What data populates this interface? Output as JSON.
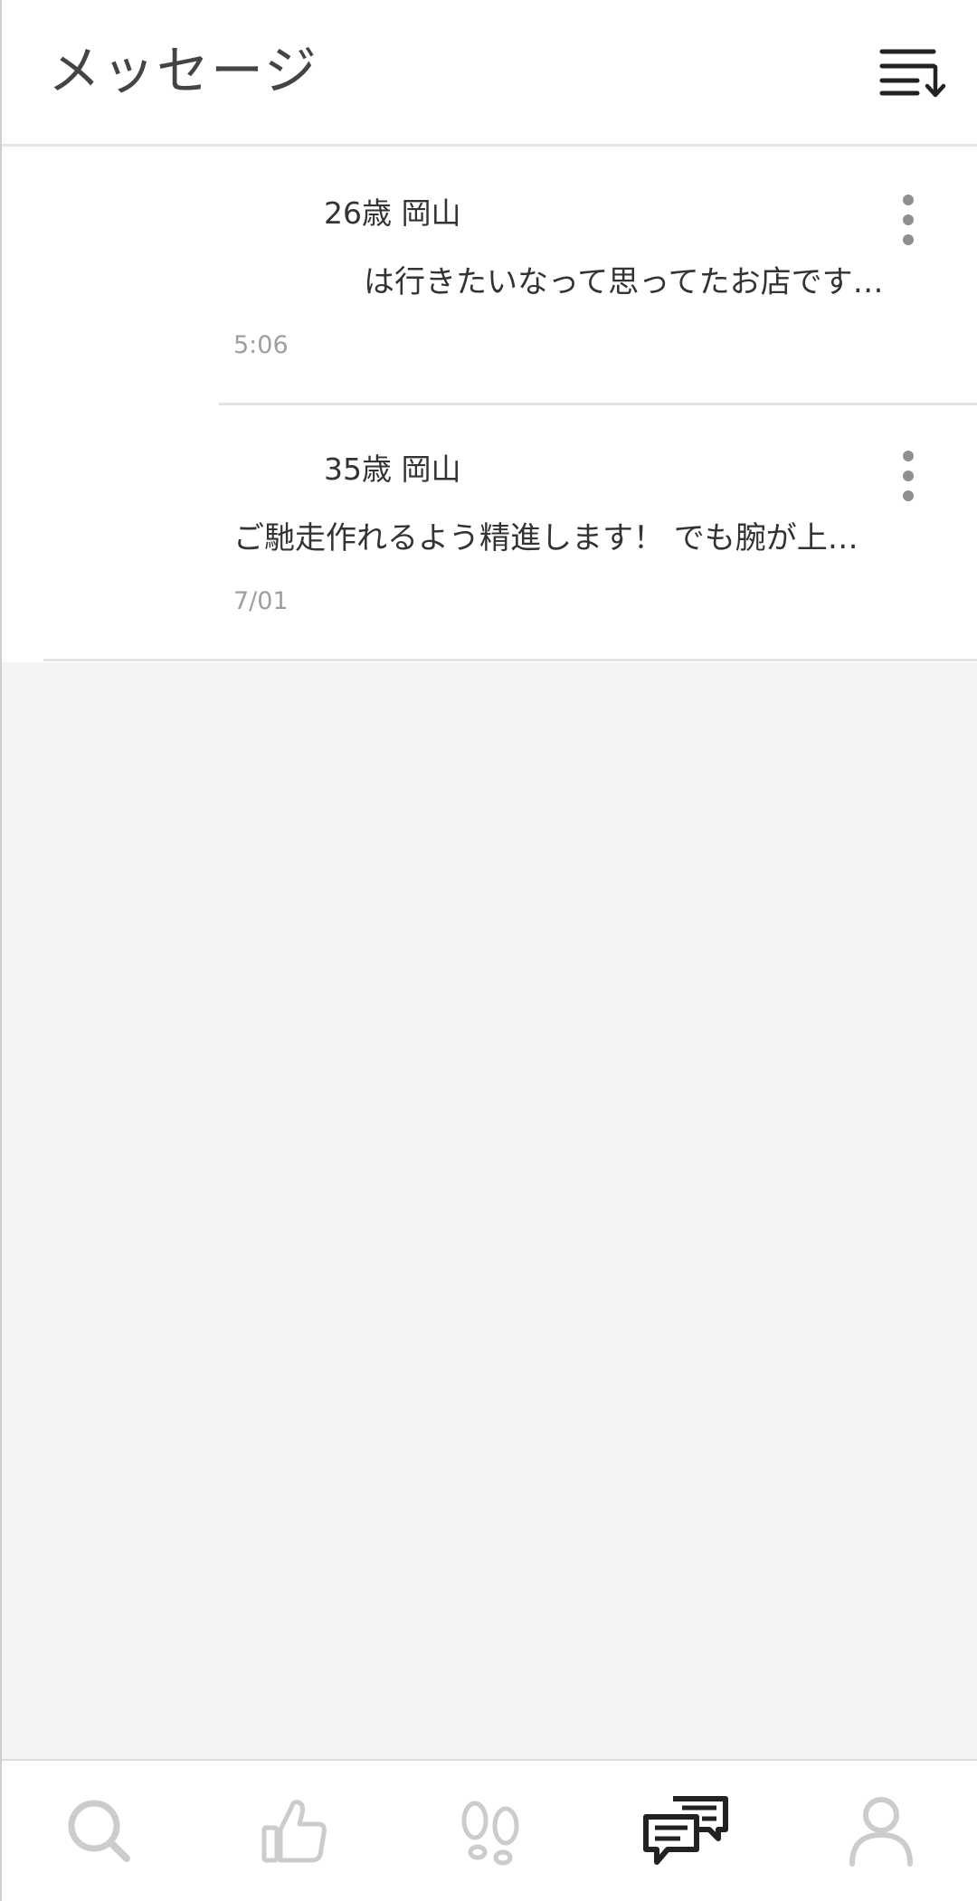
{
  "header": {
    "title": "メッセージ",
    "sort_icon": "sort-descending-icon"
  },
  "messages": [
    {
      "name": "26歳 岡山",
      "preview": "は行きたいなって思ってたお店です…",
      "time": "5:06"
    },
    {
      "name": "35歳 岡山",
      "preview": "ご馳走作れるよう精進します！ でも腕が上…",
      "time": "7/01"
    }
  ],
  "bottom_nav": {
    "items": [
      {
        "icon": "search-icon",
        "active": false
      },
      {
        "icon": "thumbs-up-icon",
        "active": false
      },
      {
        "icon": "footprints-icon",
        "active": false
      },
      {
        "icon": "chat-bubbles-icon",
        "active": true
      },
      {
        "icon": "person-icon",
        "active": false
      }
    ]
  },
  "colors": {
    "active_icon": "#222222",
    "inactive_icon": "#cccccc",
    "time_text": "#9e9e9e",
    "empty_background": "#f4f4f4"
  }
}
